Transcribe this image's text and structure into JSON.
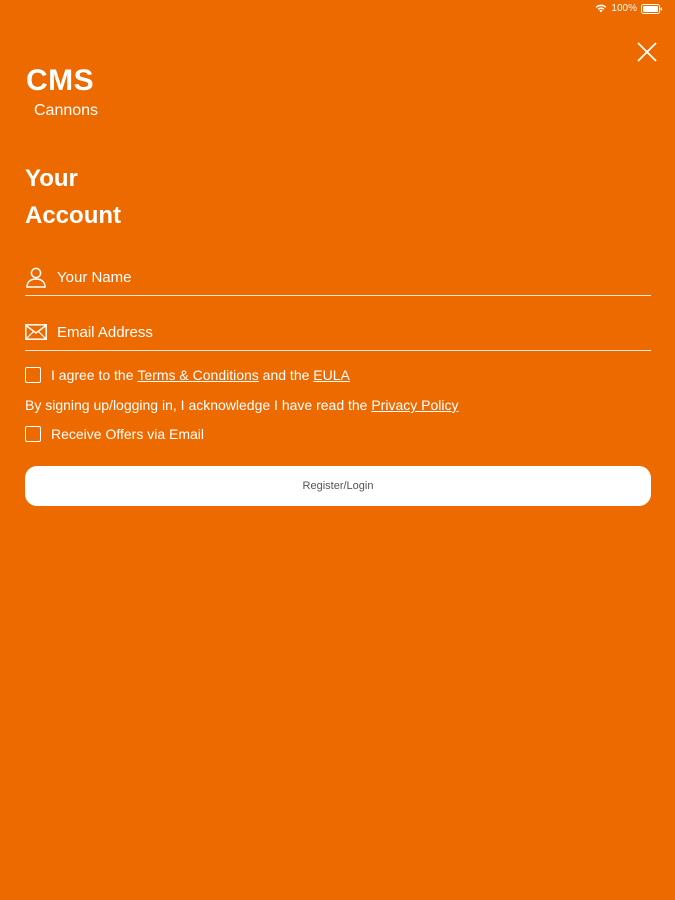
{
  "status_bar": {
    "battery_text": "100%",
    "icons": [
      "wifi-icon",
      "battery-icon"
    ]
  },
  "close_icon": "close-icon",
  "logo": {
    "mark": "CMS",
    "subtitle": "Cannons"
  },
  "title_line1": "Your",
  "title_line2": "Account",
  "form": {
    "name_placeholder": "Your Name",
    "name_value": "",
    "name_icon": "user-icon",
    "email_placeholder": "Email Address",
    "email_value": "",
    "email_icon": "envelope-icon",
    "terms": {
      "prefix": "I agree to the ",
      "terms_link": "Terms & Conditions",
      "middle": " and the ",
      "eula_link": "EULA",
      "checked": false
    },
    "acknowledge": {
      "prefix": "By signing up/logging in, I acknowledge I have read the ",
      "privacy_link": "Privacy Policy"
    },
    "offers": {
      "label": "Receive Offers via Email",
      "checked": false
    },
    "submit_label": "Register/Login"
  },
  "colors": {
    "background": "#EC6A00",
    "text": "#FFFFFF",
    "button_bg": "#FFFFFF",
    "button_text": "#555555"
  }
}
